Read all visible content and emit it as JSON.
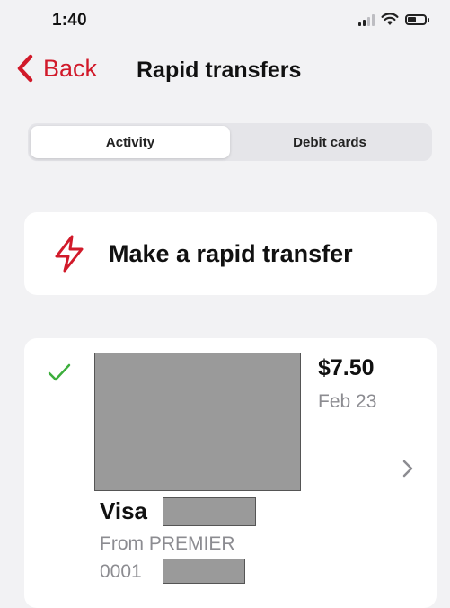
{
  "status_bar": {
    "time": "1:40",
    "icons": [
      "signal-icon",
      "wifi-icon",
      "battery-icon"
    ]
  },
  "nav": {
    "back_label": "Back",
    "title": "Rapid transfers",
    "back_icon": "chevron-left-icon"
  },
  "tabs": [
    {
      "label": "Activity",
      "active": true
    },
    {
      "label": "Debit cards",
      "active": false
    }
  ],
  "action_card": {
    "label": "Make a rapid transfer",
    "icon": "bolt-icon"
  },
  "transaction": {
    "status_icon": "check-icon",
    "amount": "$7.50",
    "date": "Feb 23",
    "brand": "Visa",
    "from": "From PREMIER",
    "account": "0001"
  },
  "colors": {
    "accent": "#d11a2a",
    "success": "#3cae3c",
    "background": "#f2f2f4",
    "muted_text": "#8c8c91"
  }
}
